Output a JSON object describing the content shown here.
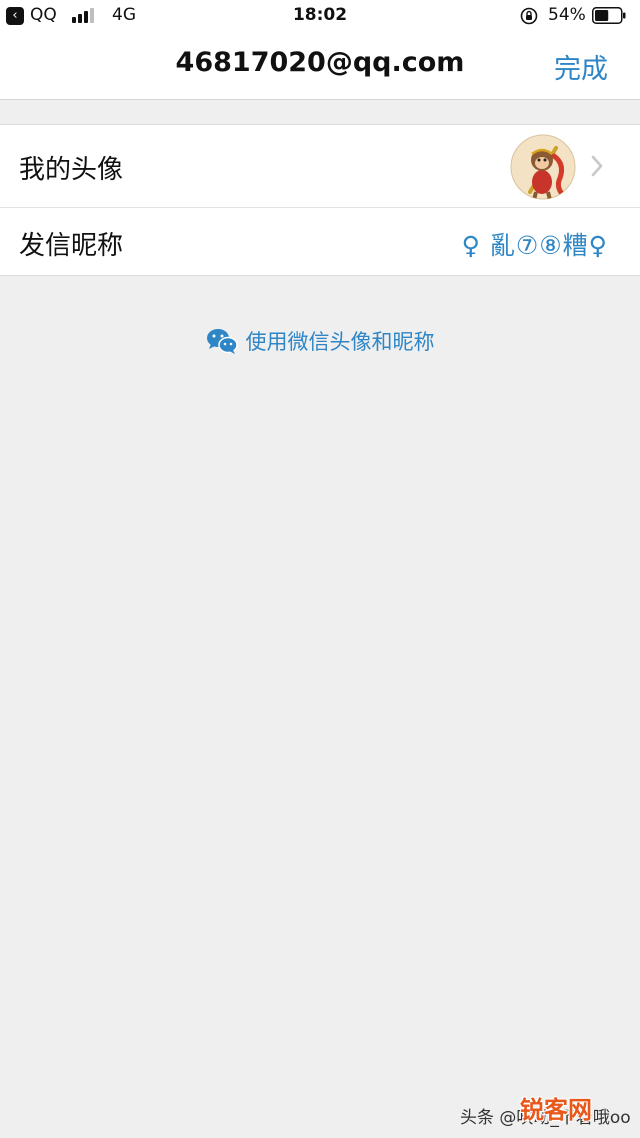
{
  "status_bar": {
    "carrier": "QQ",
    "network": "4G",
    "time": "18:02",
    "battery_pct": "54%",
    "battery_level": 0.54,
    "icons": [
      "back-arrow-icon",
      "signal-icon",
      "orientation-lock-icon",
      "battery-icon"
    ]
  },
  "nav": {
    "title": "46817020@qq.com",
    "done_label": "完成"
  },
  "rows": {
    "avatar_label": "我的头像",
    "nickname_label": "发信昵称",
    "nickname_value": "♀ 亂⑦⑧糟♀"
  },
  "wechat_link": {
    "label": "使用微信头像和昵称",
    "icon": "wechat-icon"
  },
  "watermark": {
    "toutiao": "头条 @吹动_下着哦oo",
    "site": "锐客网"
  },
  "colors": {
    "accent": "#2f86c6",
    "background": "#efeff0"
  }
}
